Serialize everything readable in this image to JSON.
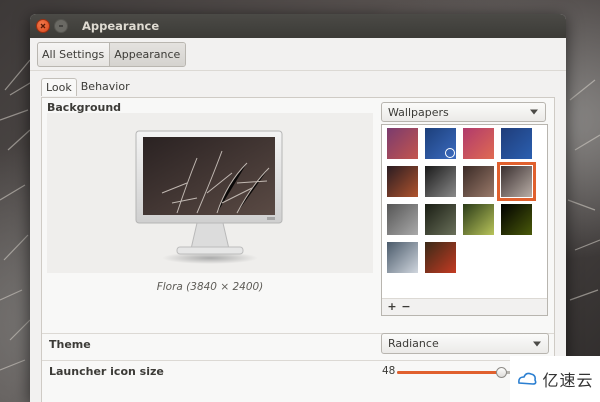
{
  "window": {
    "title": "Appearance"
  },
  "breadcrumb": {
    "items": [
      "All Settings",
      "Appearance"
    ]
  },
  "tabs": [
    "Look",
    "Behavior"
  ],
  "background": {
    "label": "Background",
    "caption": "Flora (3840 × 2400)",
    "source_dropdown": "Wallpapers",
    "thumbnails": [
      {
        "name": "purple-gradient",
        "colors": [
          "#7a3b6e",
          "#c4554e"
        ]
      },
      {
        "name": "blue-clock",
        "colors": [
          "#1c3f7a",
          "#3b6bc0"
        ],
        "current": true
      },
      {
        "name": "pink-gradient",
        "colors": [
          "#b03a6c",
          "#e06a52"
        ]
      },
      {
        "name": "blue-swirl",
        "colors": [
          "#1f3d7a",
          "#2b5fb0"
        ]
      },
      {
        "name": "sunset",
        "colors": [
          "#2a1c22",
          "#b0542e"
        ]
      },
      {
        "name": "clock-dark",
        "colors": [
          "#1a1a1a",
          "#8a8a8a"
        ]
      },
      {
        "name": "macro-gears",
        "colors": [
          "#3a2a26",
          "#9a7a6a"
        ]
      },
      {
        "name": "flora",
        "colors": [
          "#3a3030",
          "#b8ada6"
        ],
        "selected": true
      },
      {
        "name": "grey-plant",
        "colors": [
          "#555",
          "#aaa"
        ]
      },
      {
        "name": "dark-flowers",
        "colors": [
          "#1a1e14",
          "#6a705a"
        ]
      },
      {
        "name": "green-leaves",
        "colors": [
          "#2a3a18",
          "#b8c45a"
        ]
      },
      {
        "name": "firefly",
        "colors": [
          "#000",
          "#4a5a0a"
        ]
      },
      {
        "name": "stones",
        "colors": [
          "#4a5a6a",
          "#d0d6de"
        ]
      },
      {
        "name": "tulips",
        "colors": [
          "#3a2a18",
          "#c43a22"
        ]
      }
    ],
    "add_label": "+",
    "remove_label": "−"
  },
  "theme": {
    "label": "Theme",
    "value": "Radiance"
  },
  "launcher": {
    "label": "Launcher icon size",
    "value": "48",
    "fraction": 0.87
  },
  "watermark": {
    "text": "亿速云"
  },
  "colors": {
    "accent": "#e0602e",
    "titlebar": "#3c3b37"
  }
}
